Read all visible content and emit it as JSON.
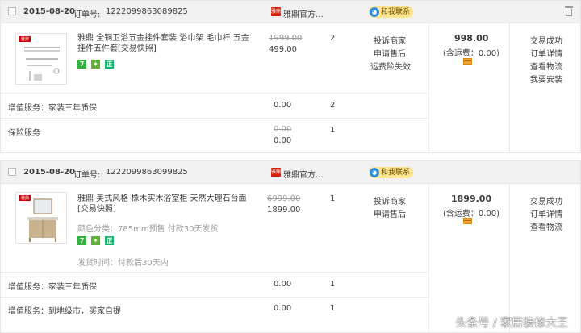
{
  "orders": [
    {
      "date": "2015-08-20",
      "order_no_label": "订单号:",
      "order_no": "1222099863089825",
      "shop_logo_text": "雅鼎",
      "shop_name": "雅鼎官方...",
      "contact_label": "和我联系",
      "brand_mark": "雅鼎",
      "item_title": "雅鼎 全铜卫浴五金挂件套装 浴巾架 毛巾杆 五金挂件五件套[交易快照]",
      "tags": [
        "7",
        "",
        "正"
      ],
      "original_price": "1999.00",
      "price": "499.00",
      "quantity": "2",
      "item_actions": [
        "投诉商家",
        "申请售后",
        "运费险失效"
      ],
      "total": "998.00",
      "shipping": "(含运费：0.00)",
      "status_links": [
        "交易成功",
        "订单详情",
        "查看物流",
        "我要安装"
      ],
      "services": [
        {
          "label": "增值服务：家装三年质保",
          "price": "0.00",
          "quantity": "2"
        },
        {
          "label": "保险服务",
          "original_price": "0.00",
          "price": "0.00",
          "quantity": "1"
        }
      ]
    },
    {
      "date": "2015-08-20",
      "order_no_label": "订单号:",
      "order_no": "1222099863099825",
      "shop_logo_text": "雅鼎",
      "shop_name": "雅鼎官方...",
      "contact_label": "和我联系",
      "brand_mark": "雅鼎",
      "item_title": "雅鼎 美式风格 橡木实木浴室柜 天然大理石台面[交易快照]",
      "spec": "颜色分类：785mm预售 付款30天发货",
      "tags": [
        "7",
        "",
        "正"
      ],
      "ship_time": "发货时间：付款后30天内",
      "original_price": "6999.00",
      "price": "1899.00",
      "quantity": "1",
      "item_actions": [
        "投诉商家",
        "申请售后"
      ],
      "total": "1899.00",
      "shipping": "(含运费：0.00)",
      "status_links": [
        "交易成功",
        "订单详情",
        "查看物流"
      ],
      "services": [
        {
          "label": "增值服务：家装三年质保",
          "price": "0.00",
          "quantity": "1"
        },
        {
          "label": "增值服务：到地级市，买家自提",
          "price": "0.00",
          "quantity": "1"
        }
      ]
    }
  ],
  "watermark": "头条号 / 家居装修大王"
}
